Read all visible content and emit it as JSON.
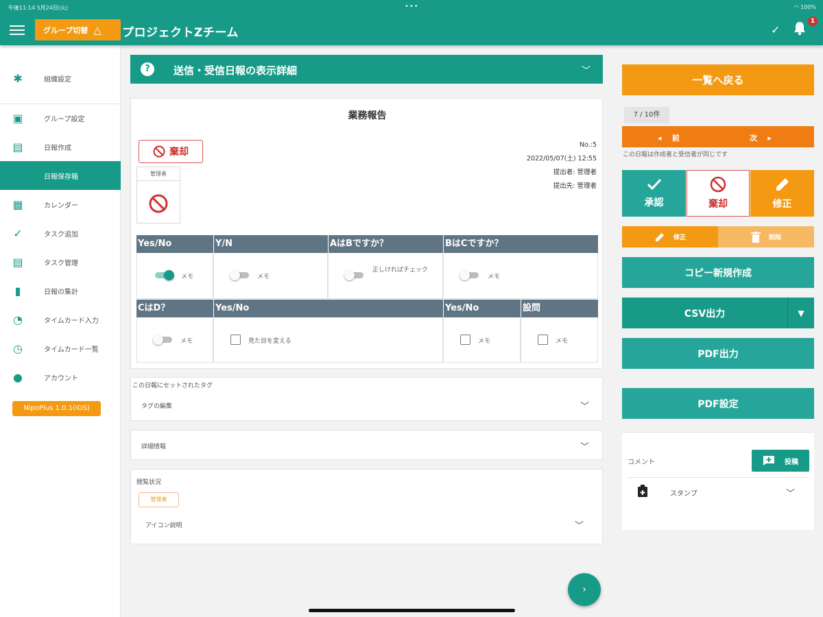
{
  "statusbar": {
    "time": "午後11:14  5月24日(火)",
    "battery": "100%"
  },
  "header": {
    "group_switch": "グループ切替",
    "title": "プロジェクトZチーム",
    "notification_count": "1"
  },
  "sidebar": {
    "items": [
      {
        "label": "組織設定",
        "icon": "gear-icon"
      },
      {
        "label": "グループ設定",
        "icon": "group-settings-icon"
      },
      {
        "label": "日報作成",
        "icon": "report-create-icon"
      },
      {
        "label": "日報保存箱",
        "icon": "archive-icon"
      },
      {
        "label": "カレンダー",
        "icon": "calendar-icon"
      },
      {
        "label": "タスク追加",
        "icon": "task-add-icon"
      },
      {
        "label": "タスク管理",
        "icon": "task-manage-icon"
      },
      {
        "label": "日報の集計",
        "icon": "chart-icon"
      },
      {
        "label": "タイムカード入力",
        "icon": "timecard-input-icon"
      },
      {
        "label": "タイムカード一覧",
        "icon": "clock-icon"
      },
      {
        "label": "アカウント",
        "icon": "account-icon"
      }
    ],
    "version": "NipoPlus 1.0.1(iOS)"
  },
  "main": {
    "detail_bar": "送信・受信日報の表示詳細",
    "report": {
      "title": "業務報告",
      "reject_label": "棄却",
      "approver": "管理者",
      "meta": {
        "number": "No.:5",
        "date": "2022/05/07(土) 12:55",
        "submitter": "提出者: 管理者",
        "recipient": "提出先: 管理者"
      },
      "row1_headers": [
        "Yes/No",
        "Y/N",
        "AはBですか？",
        "BはCですか？"
      ],
      "row1_cells": [
        "メモ",
        "メモ",
        "正しければチェック",
        "メモ"
      ],
      "row2_headers": [
        "CはD？",
        "Yes/No",
        "Yes/No",
        "設問"
      ],
      "row2_cells": [
        "メモ",
        "見た目を変える",
        "メモ",
        "メモ"
      ]
    },
    "tags": {
      "caption": "この日報にセットされたタグ",
      "edit_label": "タグの編集"
    },
    "details_label": "詳細情報",
    "view_status": {
      "caption": "閲覧状況",
      "viewer": "管理者",
      "icon_help": "アイコン説明"
    }
  },
  "right": {
    "back_label": "一覧へ戻る",
    "page_count": "7 / 10件",
    "prev_label": "前",
    "next_label": "次",
    "note": "この日報は作成者と受信者が同じです",
    "approve_label": "承認",
    "reject_label": "棄却",
    "edit_label": "修正",
    "sub_edit_label": "修正",
    "sub_delete_label": "削除",
    "copy_label": "コピー新規作成",
    "csv_label": "CSV出力",
    "pdf_label": "PDF出力",
    "pdf_settings_label": "PDF設定",
    "comment_label": "コメント",
    "post_label": "投稿",
    "stamp_label": "スタンプ"
  },
  "colors": {
    "primary": "#179b88",
    "accent": "#f39a12",
    "danger": "#d9534f",
    "grid_header": "#5f7583"
  }
}
